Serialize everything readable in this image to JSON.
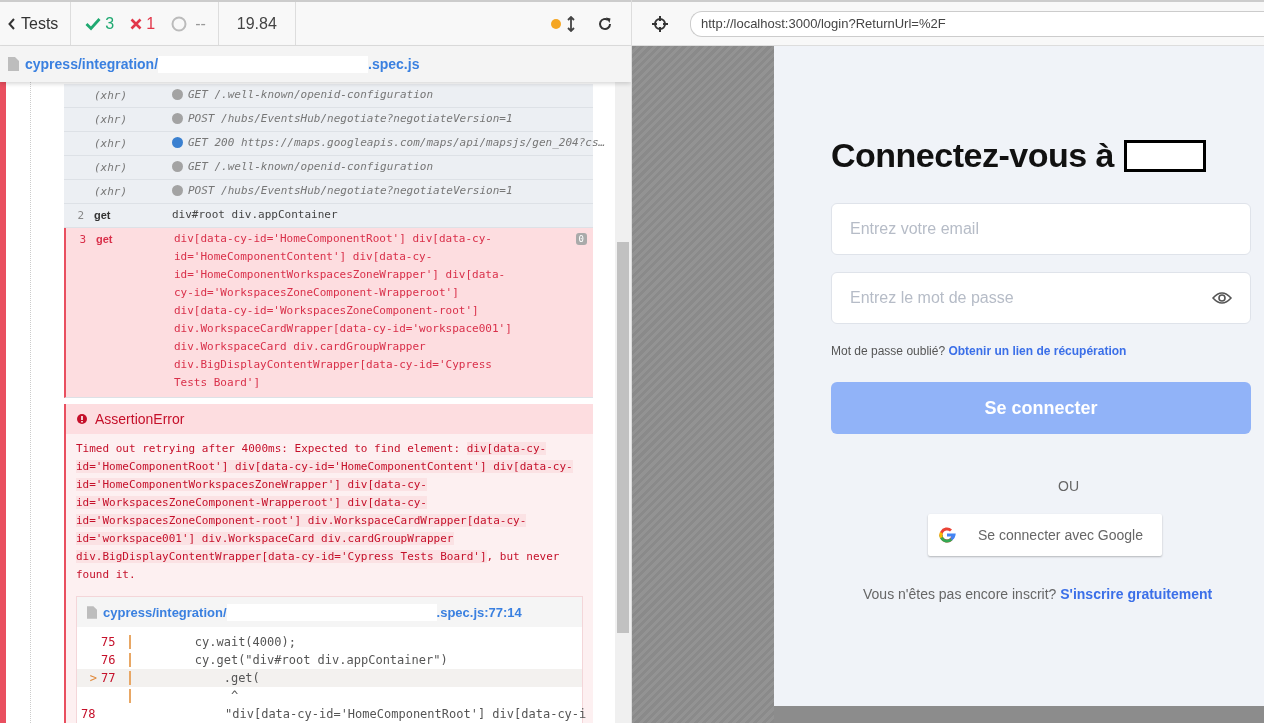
{
  "runner": {
    "back_label": "Tests",
    "passed": "3",
    "failed": "1",
    "pending": "--",
    "duration": "19.84"
  },
  "spec": {
    "path_start": "cypress/integration/",
    "path_end": ".spec.js"
  },
  "commands": [
    {
      "kind": "xhr",
      "name": "(xhr)",
      "message": "GET /.well-known/openid-configuration",
      "color": "#a3a3a3",
      "failed": false
    },
    {
      "kind": "xhr",
      "name": "(xhr)",
      "message": "POST /hubs/EventsHub/negotiate?negotiateVersion=1",
      "color": "#a3a3a3",
      "failed": false
    },
    {
      "kind": "xhr",
      "name": "(xhr)",
      "message": "GET 200 https://maps.googleapis.com/maps/api/mapsjs/gen_204?cs…",
      "color": "#3a80d0",
      "failed": false
    },
    {
      "kind": "xhr",
      "name": "(xhr)",
      "message": "GET /.well-known/openid-configuration",
      "color": "#a3a3a3",
      "failed": false
    },
    {
      "kind": "xhr",
      "name": "(xhr)",
      "message": "POST /hubs/EventsHub/negotiate?negotiateVersion=1",
      "color": "#a3a3a3",
      "failed": false
    },
    {
      "kind": "command",
      "number": "2",
      "name": "get",
      "message": "div#root div.appContainer",
      "failed": false
    },
    {
      "kind": "command",
      "number": "3",
      "name": "get",
      "message": "div[data-cy-id='HomeComponentRoot'] div[data-cy-id='HomeComponentContent'] div[data-cy-id='HomeComponentWorkspacesZoneWrapper'] div[data-cy-id='WorkspacesZoneComponent-Wrapperoot'] div[data-cy-id='WorkspacesZoneComponent-root'] div.WorkspaceCardWrapper[data-cy-id='workspace001'] div.WorkspaceCard div.cardGroupWrapper div.BigDisplayContentWrapper[data-cy-id='Cypress Tests Board']",
      "badge": "0",
      "failed": true
    }
  ],
  "error": {
    "title": "AssertionError",
    "message_before": "Timed out retrying after 4000ms: Expected to find element: ",
    "selector": "div[data-cy-id='HomeComponentRoot'] div[data-cy-id='HomeComponentContent'] div[data-cy-id='HomeComponentWorkspacesZoneWrapper'] div[data-cy-id='WorkspacesZoneComponent-Wrapperoot'] div[data-cy-id='WorkspacesZoneComponent-root'] div.WorkspaceCardWrapper[data-cy-id='workspace001']  div.WorkspaceCard div.cardGroupWrapper div.BigDisplayContentWrapper[data-cy-id='Cypress Tests Board']",
    "message_after": ", but never found it.",
    "file_start": "cypress/integration/",
    "file_end": ".spec.js:77:14",
    "code": [
      {
        "line": "75",
        "code": "        cy.wait(4000);",
        "current": false
      },
      {
        "line": "76",
        "code": "        cy.get(\"div#root div.appContainer\")",
        "current": false
      },
      {
        "line": "77",
        "marker": ">",
        "code": "            .get(",
        "current": true
      },
      {
        "code": "             ^",
        "current": false
      },
      {
        "line": "78",
        "code": "                \"div[data-cy-id='HomeComponentRoot'] div[data-cy-i",
        "current": false
      }
    ]
  },
  "browser": {
    "url": "http://localhost:3000/login?ReturnUrl=%2F"
  },
  "login": {
    "title": "Connectez-vous à",
    "email_placeholder": "Entrez votre email",
    "password_placeholder": "Entrez le mot de passe",
    "forgot": "Mot de passe oublié?",
    "forgot_link": "Obtenir un lien de récupération",
    "submit": "Se connecter",
    "submit_disabled": true,
    "or": "OU",
    "google": "Se connecter avec Google",
    "signup": "Vous n'êtes pas encore inscrit?",
    "signup_link": "S'inscrire gratuitement"
  }
}
